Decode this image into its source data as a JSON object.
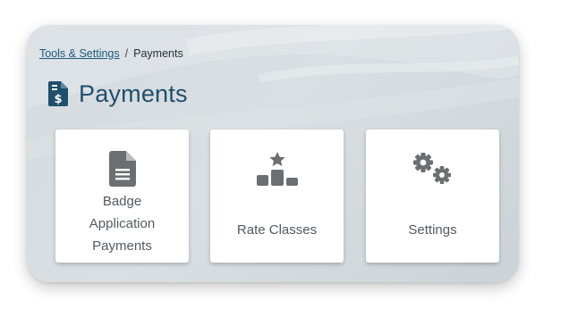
{
  "breadcrumb": {
    "parent_label": "Tools & Settings",
    "separator": "/",
    "current_label": "Payments"
  },
  "header": {
    "title": "Payments",
    "icon": "file-invoice-dollar-icon"
  },
  "cards": [
    {
      "label_lines": [
        "Badge",
        "Application",
        "Payments"
      ],
      "icon": "file-document-icon"
    },
    {
      "label_lines": [
        "Rate Classes"
      ],
      "icon": "ranking-podium-icon"
    },
    {
      "label_lines": [
        "Settings"
      ],
      "icon": "gears-icon"
    }
  ],
  "colors": {
    "title": "#1f4f6d",
    "link": "#1d5a7a",
    "icon_gray": "#6b6f72",
    "panel_bg": "#d6dce0"
  }
}
